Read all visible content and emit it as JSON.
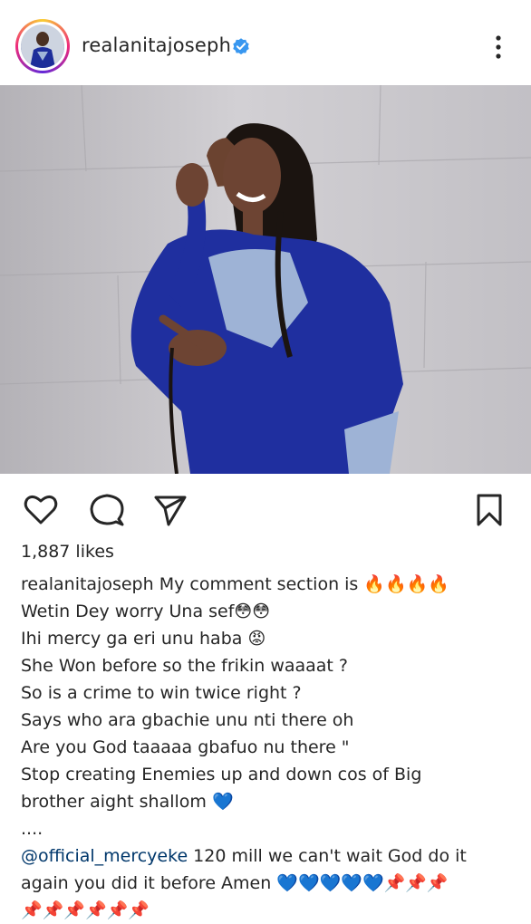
{
  "post": {
    "username": "realanitajoseph",
    "likes": "1,887 likes"
  },
  "icons": {
    "verified": "verified-badge-icon",
    "more": "more-options-icon",
    "like": "heart-icon",
    "comment": "comment-icon",
    "share": "send-icon",
    "save": "bookmark-icon"
  },
  "colors": {
    "verified": "#3897f0",
    "mention": "#00376b"
  },
  "caption": {
    "username": "realanitajoseph",
    "line1": " My comment section is 🔥🔥🔥🔥",
    "line2": "Wetin Dey worry Una sef😳😳",
    "line3": "Ihi mercy ga eri unu haba 😡",
    "line4": "She Won before so the frikin waaaat ?",
    "line5": "So is a crime to win twice right ?",
    "line6": "Says who ara gbachie unu nti there oh",
    "line7": "Are you God taaaaa gbafuo nu there \"",
    "line8": "Stop creating Enemies up and down cos of Big",
    "line9": "brother aight shallom 💙",
    "line10": "....",
    "mention": "@official_mercyeke",
    "line11": " 120 mill we can't wait God do it",
    "line12": "again you did it before Amen 💙💙💙💙💙📌📌📌",
    "line13": "📌📌📌📌📌📌"
  }
}
